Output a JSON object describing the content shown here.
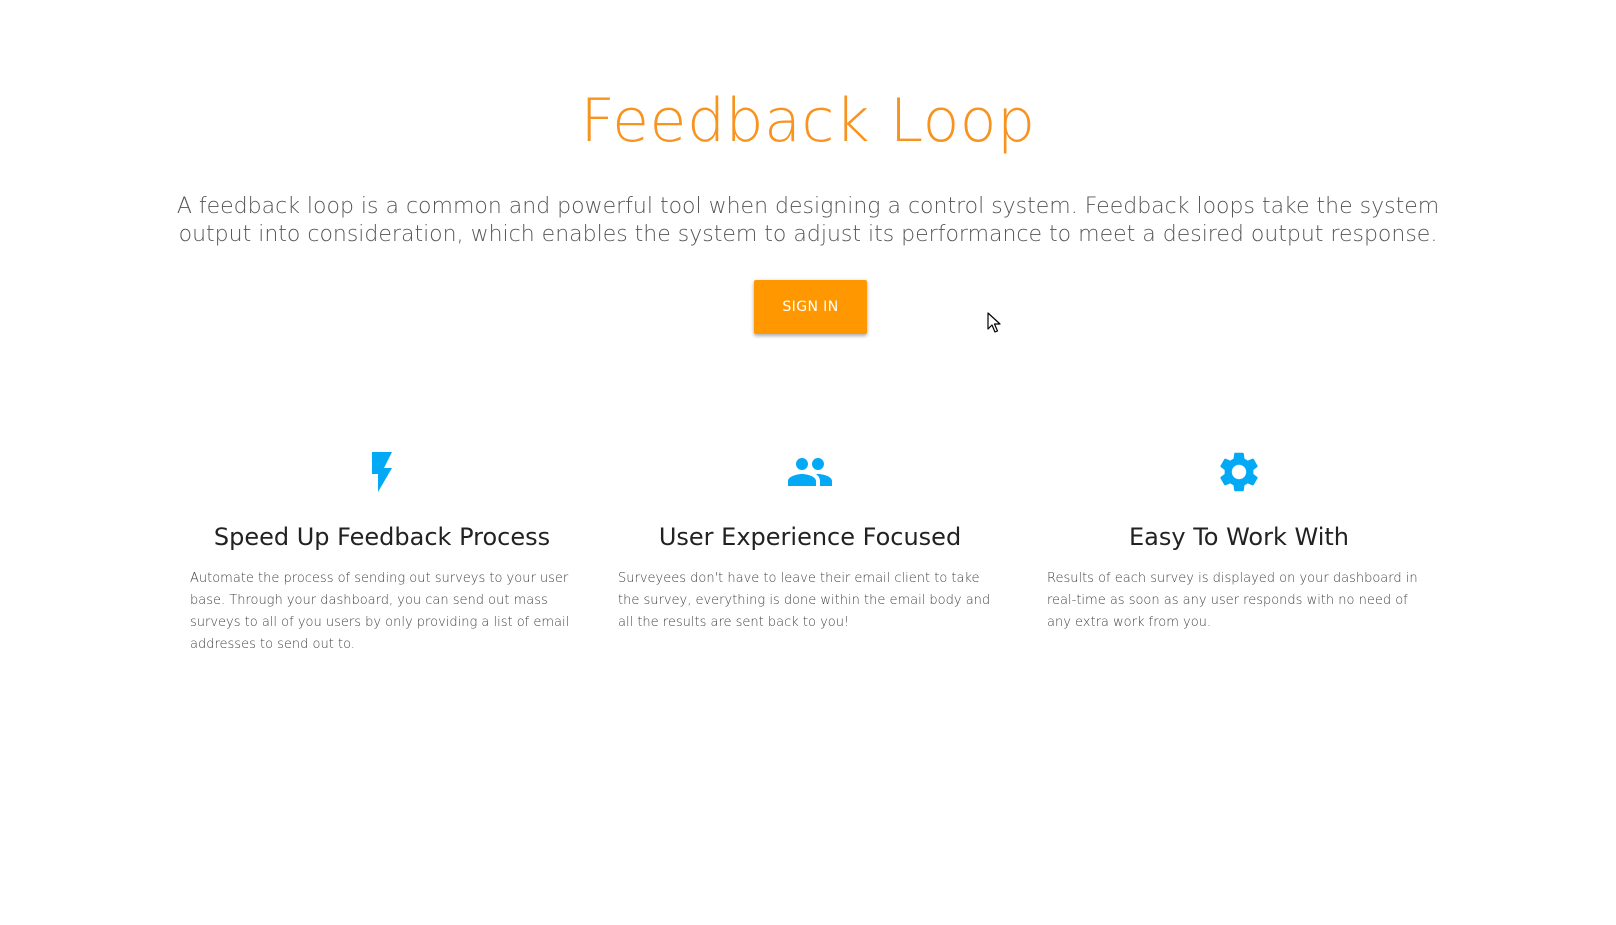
{
  "hero": {
    "title": "Feedback Loop",
    "description": "A feedback loop is a common and powerful tool when designing a control system. Feedback loops take the system output into consideration, which enables the system to adjust its performance to meet a desired output response.",
    "signin_label": "SIGN IN"
  },
  "features": [
    {
      "icon": "lightning-bolt-icon",
      "title": "Speed Up Feedback Process",
      "text": "Automate the process of sending out surveys to your user base. Through your dashboard, you can send out mass surveys to all of you users by only providing a list of email addresses to send out to."
    },
    {
      "icon": "people-group-icon",
      "title": "User Experience Focused",
      "text": "Surveyees don't have to leave their email client to take the survey, everything is done within the email body and all the results are sent back to you!"
    },
    {
      "icon": "gear-icon",
      "title": "Easy To Work With",
      "text": "Results of each survey is displayed on your dashboard in real-time as soon as any user responds with no need of any extra work from you."
    }
  ],
  "colors": {
    "brand_orange": "#f7931e",
    "button_orange": "#ff9800",
    "icon_blue": "#03a9f4"
  }
}
